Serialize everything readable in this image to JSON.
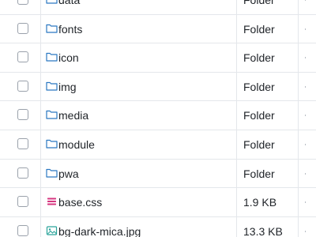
{
  "rows": [
    {
      "name": "data",
      "type": "Folder",
      "icon": "folder-icon"
    },
    {
      "name": "fonts",
      "type": "Folder",
      "icon": "folder-icon"
    },
    {
      "name": "icon",
      "type": "Folder",
      "icon": "folder-icon"
    },
    {
      "name": "img",
      "type": "Folder",
      "icon": "folder-icon"
    },
    {
      "name": "media",
      "type": "Folder",
      "icon": "folder-icon"
    },
    {
      "name": "module",
      "type": "Folder",
      "icon": "folder-icon"
    },
    {
      "name": "pwa",
      "type": "Folder",
      "icon": "folder-icon"
    },
    {
      "name": "base.css",
      "type": "1.9 KB",
      "icon": "css-file-icon"
    },
    {
      "name": "bg-dark-mica.jpg",
      "type": "13.3 KB",
      "icon": "image-file-icon"
    }
  ],
  "colors": {
    "folder_icon": "#2b78c2",
    "css_icon": "#d6357f",
    "image_icon": "#2aa39a",
    "border": "#e4e7eb"
  }
}
